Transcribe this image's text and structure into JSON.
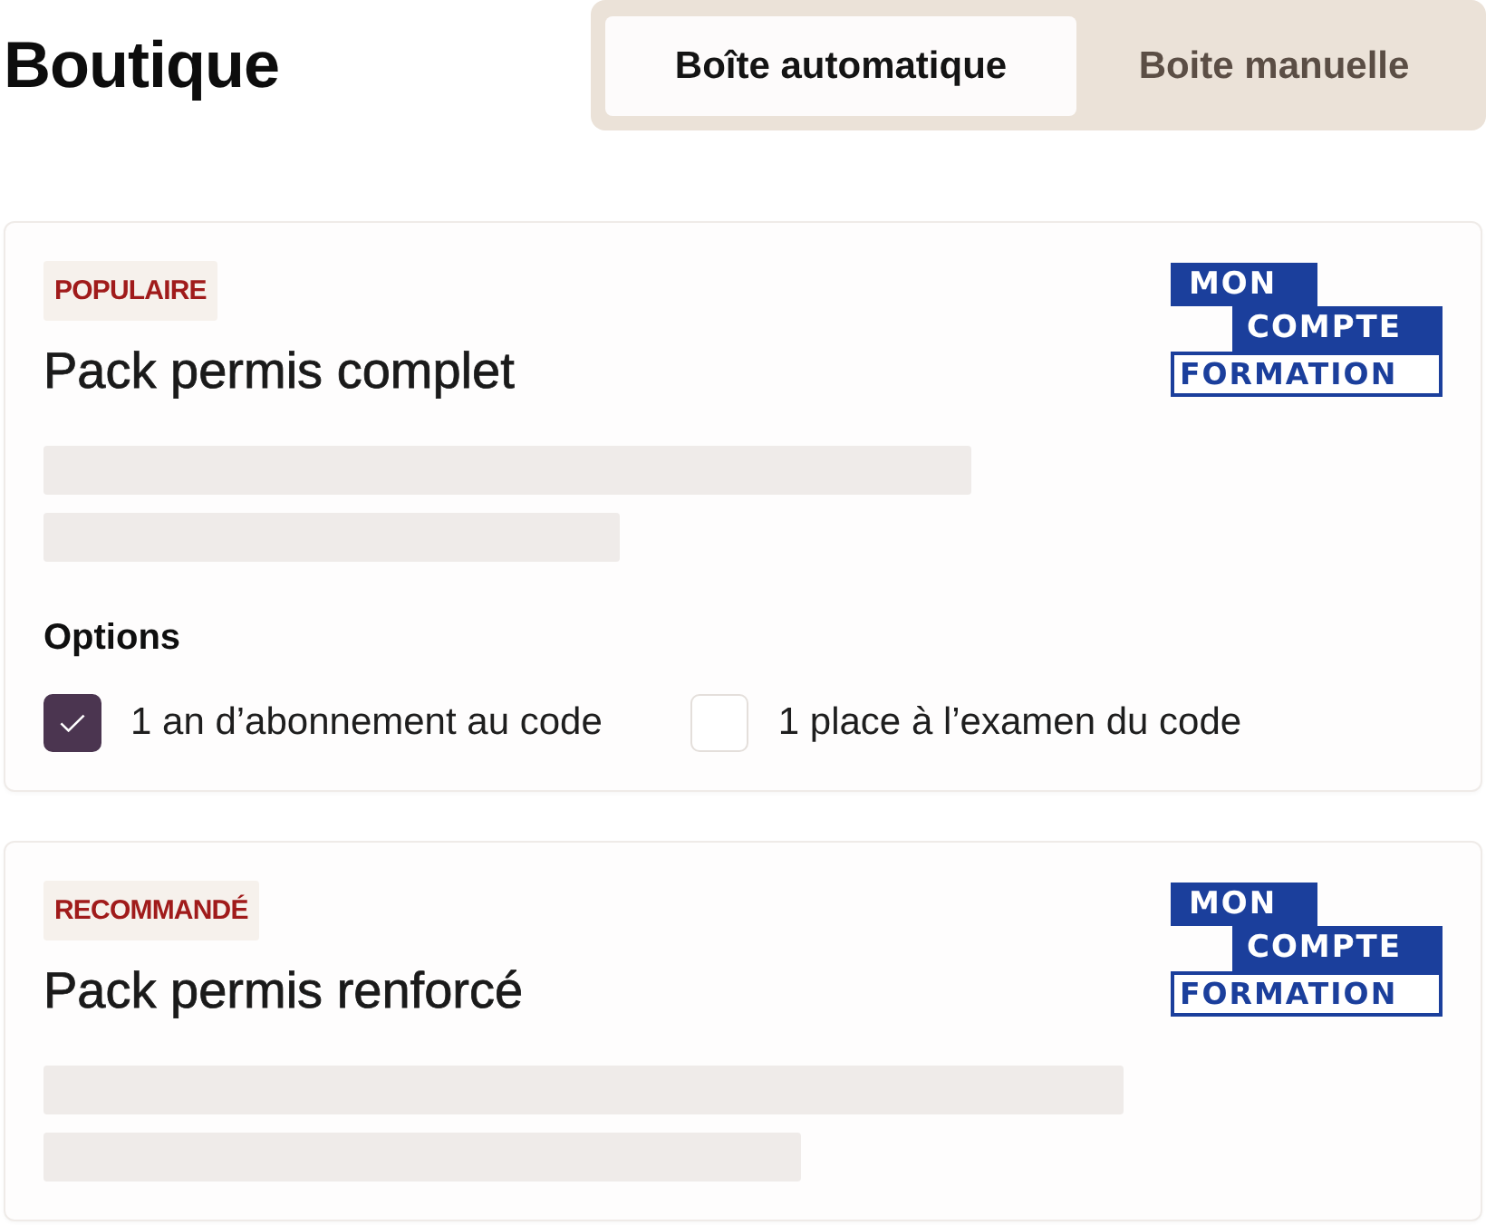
{
  "page": {
    "title": "Boutique"
  },
  "tabs": [
    {
      "label": "Boîte automatique",
      "selected": true
    },
    {
      "label": "Boite manuelle",
      "selected": false
    }
  ],
  "cards": [
    {
      "badge": "POPULAIRE",
      "title": "Pack permis complet",
      "logo": [
        "MON",
        "COMPTE",
        "FORMATION"
      ],
      "options_heading": "Options",
      "options": [
        {
          "label": "1 an d’abonnement au code",
          "checked": true
        },
        {
          "label": "1 place à l’examen du code",
          "checked": false
        }
      ]
    },
    {
      "badge": "RECOMMANDÉ",
      "title": "Pack permis renforcé",
      "logo": [
        "MON",
        "COMPTE",
        "FORMATION"
      ]
    }
  ]
}
